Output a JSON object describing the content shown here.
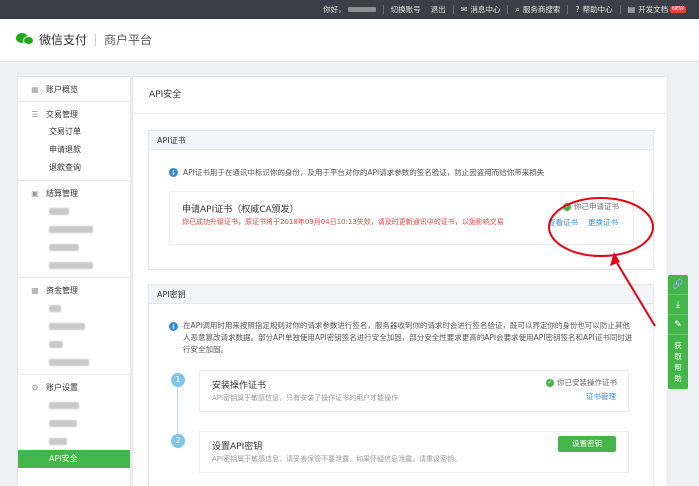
{
  "topbar": {
    "greeting": "你好，",
    "switch_account": "切换账号",
    "logout": "退出",
    "message_center": "消息中心",
    "service_search": "服务商搜索",
    "help_center": "帮助中心",
    "dev_docs": "开发文档",
    "new_badge": "NEW"
  },
  "header": {
    "brand": "微信支付",
    "subtitle": "商户平台"
  },
  "sidebar": {
    "overview": "账户概览",
    "trade": {
      "title": "交易管理",
      "items": [
        "交易订单",
        "申请退款",
        "退款查询"
      ]
    },
    "settlement": {
      "title": "结算管理"
    },
    "funds": {
      "title": "资金管理"
    },
    "account": {
      "title": "账户设置",
      "active_item": "API安全"
    }
  },
  "main": {
    "page_title": "API安全",
    "cert_panel": {
      "header": "API证书",
      "info": "API证书用于在通讯中标识你的身份，及用于平台对你的API请求参数的签名验证，防止因盗用而给你带来损失",
      "box_title": "申请API证书（权威CA颁发）",
      "warning": "你已成功升级证书，原证书将于2018年09月04日10:13失效，请及时更新通讯中的证书，以免影响交易",
      "status": "你已申请证书",
      "view_link": "查看证书",
      "change_link": "更换证书"
    },
    "key_panel": {
      "header": "API密钥",
      "info": "在API调用时用来按照指定规则对你的请求参数进行签名，服务器收到你的请求时会进行签名验证，既可以界定你的身份也可以防止其他人恶意篡改请求数据。部分API单独使用API密钥签名进行安全加固，部分安全性要求更高的API会要求使用API密钥签名和API证书同时进行安全加固。",
      "steps": [
        {
          "num": "1",
          "title": "安装操作证书",
          "desc": "API密钥属于敏感信息，只有安装了操作证书的用户才能操作",
          "status": "你已安装操作证书",
          "link": "证书管理"
        },
        {
          "num": "2",
          "title": "设置API密钥",
          "desc": "API密钥属于敏感信息，请妥善保管不要泄露，如果怀疑信息泄露，请重设密钥。",
          "button": "设置密钥"
        }
      ]
    }
  },
  "floatbar": {
    "help": "获取帮助"
  },
  "colors": {
    "brand_green": "#44b549",
    "link_blue": "#2f8ce0",
    "warning_red": "#e64340",
    "annotation_red": "#e60012"
  }
}
